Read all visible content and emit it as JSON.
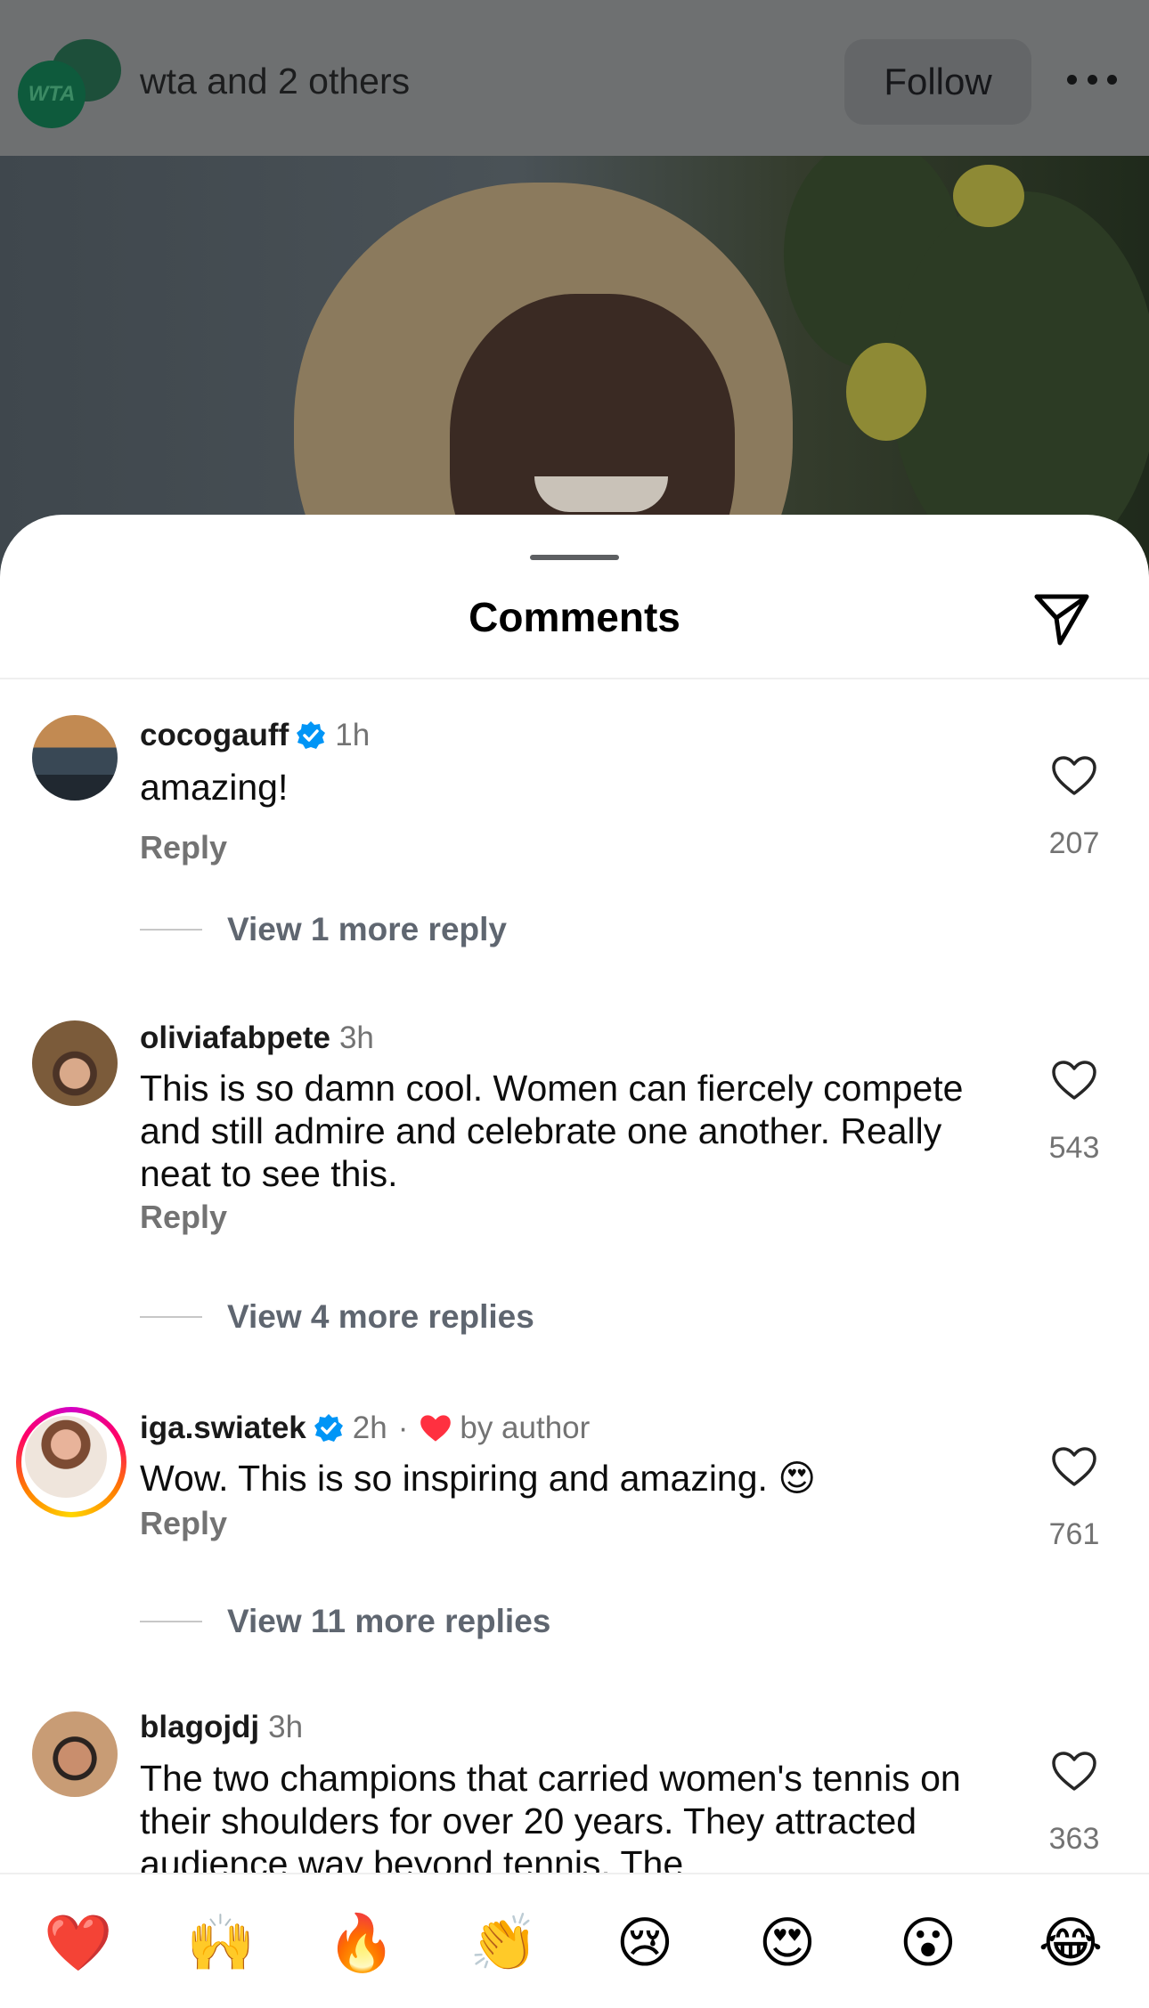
{
  "post": {
    "owner": "wta and 2 others",
    "logo_text": "WTA",
    "follow_label": "Follow"
  },
  "sheet": {
    "title": "Comments"
  },
  "comments": [
    {
      "username": "cocogauff",
      "verified": true,
      "time": "1h",
      "text": "amazing!",
      "reply_label": "Reply",
      "likes": "207",
      "view_more": "View 1 more reply"
    },
    {
      "username": "oliviafabpete",
      "verified": false,
      "time": "3h",
      "text": "This is so damn cool. Women can fiercely compete and still admire and celebrate one another. Really neat to see this.",
      "reply_label": "Reply",
      "likes": "543",
      "view_more": "View 4 more replies"
    },
    {
      "username": "iga.swiatek",
      "verified": true,
      "time": "2h",
      "separator": "·",
      "liked_by_author": "by author",
      "text": "Wow. This is so inspiring and amazing. 😍",
      "reply_label": "Reply",
      "likes": "761",
      "view_more": "View 11 more replies"
    },
    {
      "username": "blagojdj",
      "verified": false,
      "time": "3h",
      "text": "The two champions that carried women's tennis on their shoulders for over 20 years. They attracted audience way beyond tennis. The",
      "likes": "363"
    }
  ],
  "reactions": [
    "❤️",
    "🙌",
    "🔥",
    "👏",
    "😢",
    "😍",
    "😮",
    "😂"
  ],
  "colors": {
    "accent_verified": "#0095f6",
    "heart_red": "#ff3040",
    "secondary_text": "#737373"
  },
  "icons": [
    "more-icon",
    "send-icon",
    "verified-icon",
    "heart-icon",
    "liked-by-author-heart-icon"
  ]
}
